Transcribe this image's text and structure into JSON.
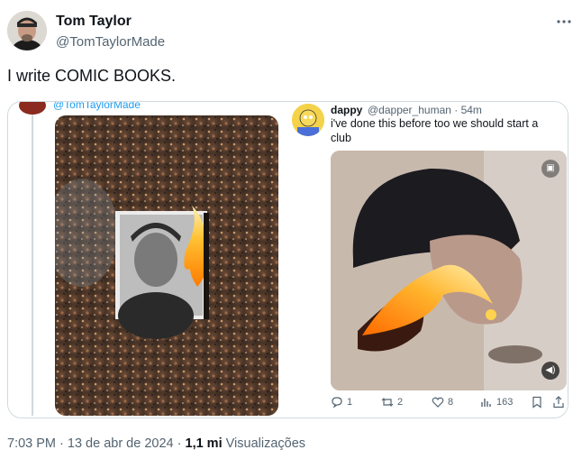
{
  "author": {
    "name": "Tom Taylor",
    "handle": "@TomTaylorMade"
  },
  "tweet": {
    "text": "I write COMIC BOOKS."
  },
  "embedded_left": {
    "handle": "@TomTaylorMade"
  },
  "embedded_reply": {
    "name": "dappy",
    "handle_time": "@dapper_human · 54m",
    "text": "i've done this before too we should start a club",
    "actions": {
      "replies": "1",
      "retweets": "2",
      "likes": "8",
      "views": "163"
    }
  },
  "footer": {
    "time_date": "7:03 PM · 13 de abr de 2024 · ",
    "views_count": "1,1 mi",
    "views_label": " Visualizações"
  },
  "icons": {
    "more": "more-horizontal-icon",
    "reply": "reply-icon",
    "retweet": "retweet-icon",
    "like": "heart-icon",
    "views": "bar-chart-icon",
    "bookmark": "bookmark-icon",
    "share": "share-icon"
  },
  "colors": {
    "text_primary": "#0f1419",
    "text_secondary": "#536471",
    "border": "#cfd9de",
    "link": "#1d9bf0"
  }
}
